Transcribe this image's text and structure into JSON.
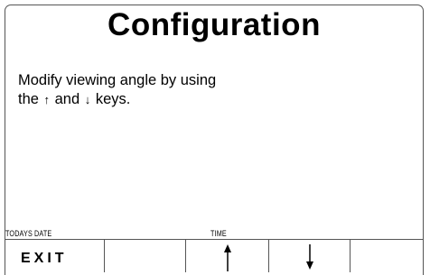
{
  "screen": {
    "title": "Configuration",
    "instructions": {
      "line1": "Modify viewing angle by using",
      "line2_prefix": "the",
      "up_key": "↑",
      "line2_middle": "and",
      "down_key": "↓",
      "line2_suffix": "keys."
    }
  },
  "status_bar": {
    "date_label": "TODAYS DATE",
    "time_label": "TIME"
  },
  "softkeys": [
    {
      "label": "EXIT",
      "icon": ""
    },
    {
      "label": "",
      "icon": ""
    },
    {
      "label": "",
      "icon": "arrow-up-icon"
    },
    {
      "label": "",
      "icon": "arrow-down-icon"
    },
    {
      "label": "",
      "icon": ""
    }
  ],
  "colors": {
    "background": "#ffffff",
    "border": "#555555",
    "text": "#000000"
  }
}
